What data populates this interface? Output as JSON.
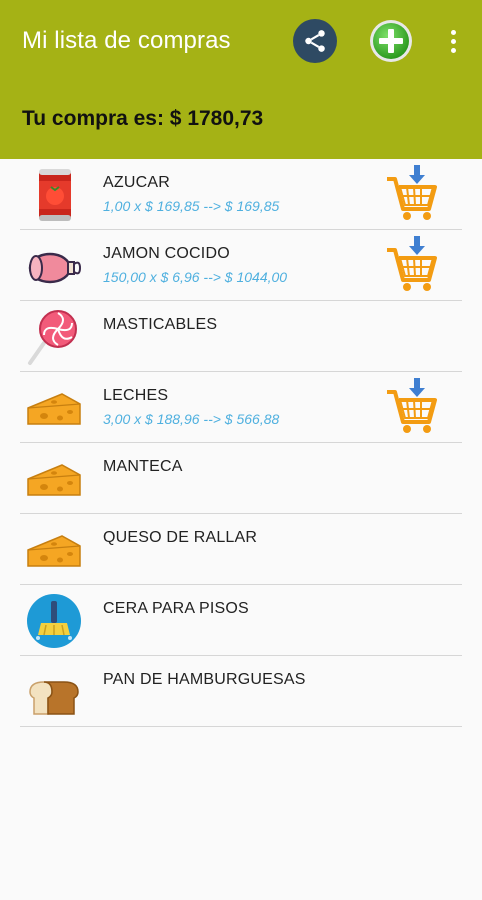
{
  "appbar": {
    "title": "Mi lista de compras",
    "color": "#a5b215",
    "actions": [
      {
        "name": "share",
        "icon": "share-icon"
      },
      {
        "name": "add",
        "icon": "add-circle-icon"
      },
      {
        "name": "more",
        "icon": "more-vert-icon"
      }
    ]
  },
  "summary": {
    "total_label": "Tu compra es: $ 1780,73"
  },
  "items": [
    {
      "name": "AZUCAR",
      "detail": "1,00 x $ 169,85 --> $ 169,85",
      "icon": "tomato-can-icon",
      "in_cart": true
    },
    {
      "name": "JAMON COCIDO",
      "detail": "150,00 x $ 6,96 --> $ 1044,00",
      "icon": "ham-icon",
      "in_cart": true
    },
    {
      "name": "MASTICABLES",
      "detail": "",
      "icon": "lollipop-icon",
      "in_cart": false
    },
    {
      "name": "LECHES",
      "detail": "3,00 x $ 188,96 --> $ 566,88",
      "icon": "cheese-icon",
      "in_cart": true
    },
    {
      "name": "MANTECA",
      "detail": "",
      "icon": "cheese-icon",
      "in_cart": false
    },
    {
      "name": "QUESO DE RALLAR",
      "detail": "",
      "icon": "cheese-icon",
      "in_cart": false
    },
    {
      "name": "CERA PARA PISOS",
      "detail": "",
      "icon": "cleaning-broom-icon",
      "in_cart": false
    },
    {
      "name": "PAN DE HAMBURGUESAS",
      "detail": "",
      "icon": "bread-icon",
      "in_cart": false
    }
  ],
  "colors": {
    "detail_text": "#4fb0df",
    "cart": "#f39c12",
    "cart_arrow": "#3f7fd1"
  }
}
